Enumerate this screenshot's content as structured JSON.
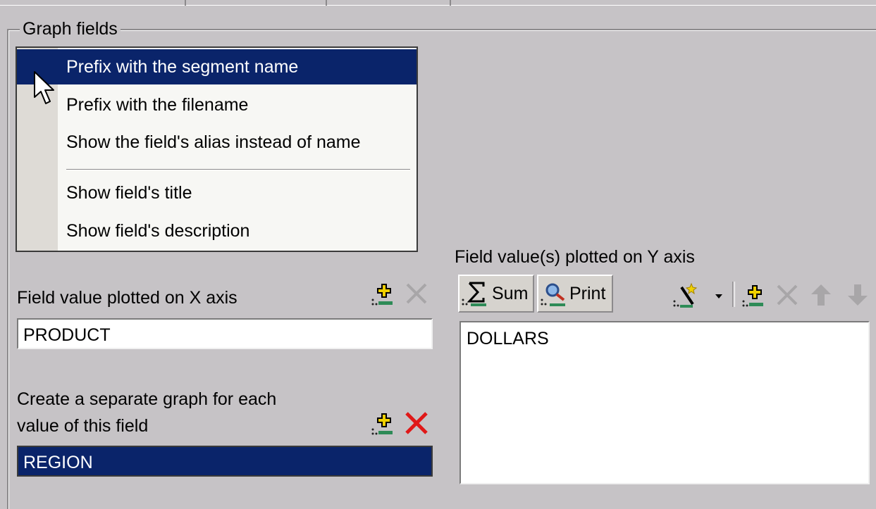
{
  "group_title": "Graph fields",
  "menu": {
    "items": [
      {
        "label": "Prefix with the segment name",
        "selected": true
      },
      {
        "label": "Prefix with the filename",
        "selected": false
      },
      {
        "label": "Show the field's alias instead of name",
        "selected": false
      },
      {
        "label": "Show field's title",
        "selected": false
      },
      {
        "label": "Show field's description",
        "selected": false
      }
    ]
  },
  "x_axis": {
    "label": "Field value plotted on X axis",
    "value": "PRODUCT",
    "icons": [
      "add-field-icon",
      "delete-icon"
    ]
  },
  "separate_graph": {
    "label_line1": "Create a separate graph for each",
    "label_line2": "value of this field",
    "value": "REGION",
    "icons": [
      "add-field-icon",
      "delete-icon"
    ]
  },
  "y_axis": {
    "label": "Field value(s) plotted on Y axis",
    "sum_label": "Sum",
    "print_label": "Print",
    "items": [
      "DOLLARS"
    ],
    "icons": [
      "sigma-icon",
      "print-field-icon",
      "wand-icon",
      "dropdown-arrow-icon",
      "add-field-icon",
      "delete-icon",
      "move-up-icon",
      "move-down-icon"
    ]
  },
  "colors": {
    "dialog_bg": "#c6c3c6",
    "selection": "#0a246a",
    "delete_red": "#e01818",
    "add_green": "#2e8b57",
    "add_yellow": "#f0d000"
  }
}
